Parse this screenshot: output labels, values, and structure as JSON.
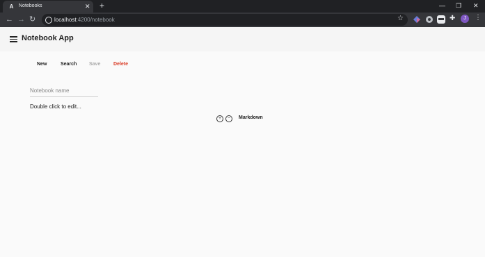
{
  "browser": {
    "tab_title": "Notebooks",
    "tab_favicon_glyph": "A",
    "url_host": "localhost",
    "url_rest": ":4200/notebook",
    "profile_initial": "J"
  },
  "app": {
    "title": "Notebook App"
  },
  "actions": {
    "new_label": "New",
    "search_label": "Search",
    "save_label": "Save",
    "delete_label": "Delete"
  },
  "notebook": {
    "name_placeholder": "Notebook name",
    "name_value": "",
    "cell_text": "Double click to edit...",
    "cell_type": "Markdown"
  },
  "colors": {
    "delete": "#d93b25",
    "disabled": "#aaaaaa",
    "chrome_dark": "#202124",
    "chrome_toolbar": "#35363a"
  }
}
